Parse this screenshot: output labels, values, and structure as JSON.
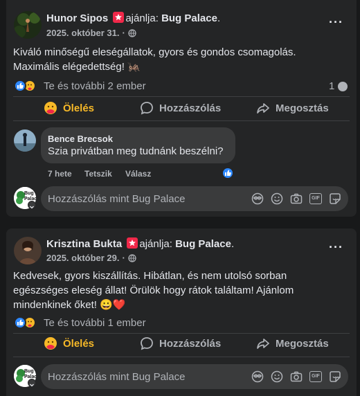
{
  "posts": [
    {
      "author": "Hunor Sipos",
      "recommends": "ajánlja:",
      "page": "Bug Palace",
      "date": "2025. október 31.",
      "body": "Kiváló minőségű eleségállatok, gyors és gondos csomagolás. Maximális elégedettség! 🦗",
      "reactions_text": "Te és további 2 ember",
      "comment_count": "1",
      "actions": {
        "hug": "Ölelés",
        "comment": "Hozzászólás",
        "share": "Megosztás"
      },
      "comment": {
        "name": "Bence Brecsok",
        "text": "Szia privátban meg tudnánk beszélni?",
        "time": "7 hete",
        "like": "Tetszik",
        "reply": "Válasz"
      },
      "composer_placeholder": "Hozzászólás mint Bug Palace"
    },
    {
      "author": "Krisztina Bukta",
      "recommends": "ajánlja:",
      "page": "Bug Palace",
      "date": "2025. október 29.",
      "body": "Kedvesek, gyors kiszállítás. Hibátlan, és nem utolsó sorban egészséges  eleség állat! Örülök hogy rátok találtam! Ajánlom mindenkinek őket! 😀❤️",
      "reactions_text": "Te és további 1 ember",
      "actions": {
        "hug": "Ölelés",
        "comment": "Hozzászólás",
        "share": "Megosztás"
      },
      "composer_placeholder": "Hozzászólás mint Bug Palace"
    }
  ],
  "colors": {
    "background": "#18191a",
    "card": "#242526",
    "bubble": "#3a3b3c",
    "hug_accent": "#f7b928",
    "like_blue": "#2d88ff",
    "recommend_red": "#f02849"
  },
  "composer_icons": [
    "avatar-sticker-icon",
    "emoji-icon",
    "camera-icon",
    "gif-icon",
    "sticker-icon"
  ],
  "gif_label": "GIF",
  "page_avatar_text": "Bug Palace"
}
